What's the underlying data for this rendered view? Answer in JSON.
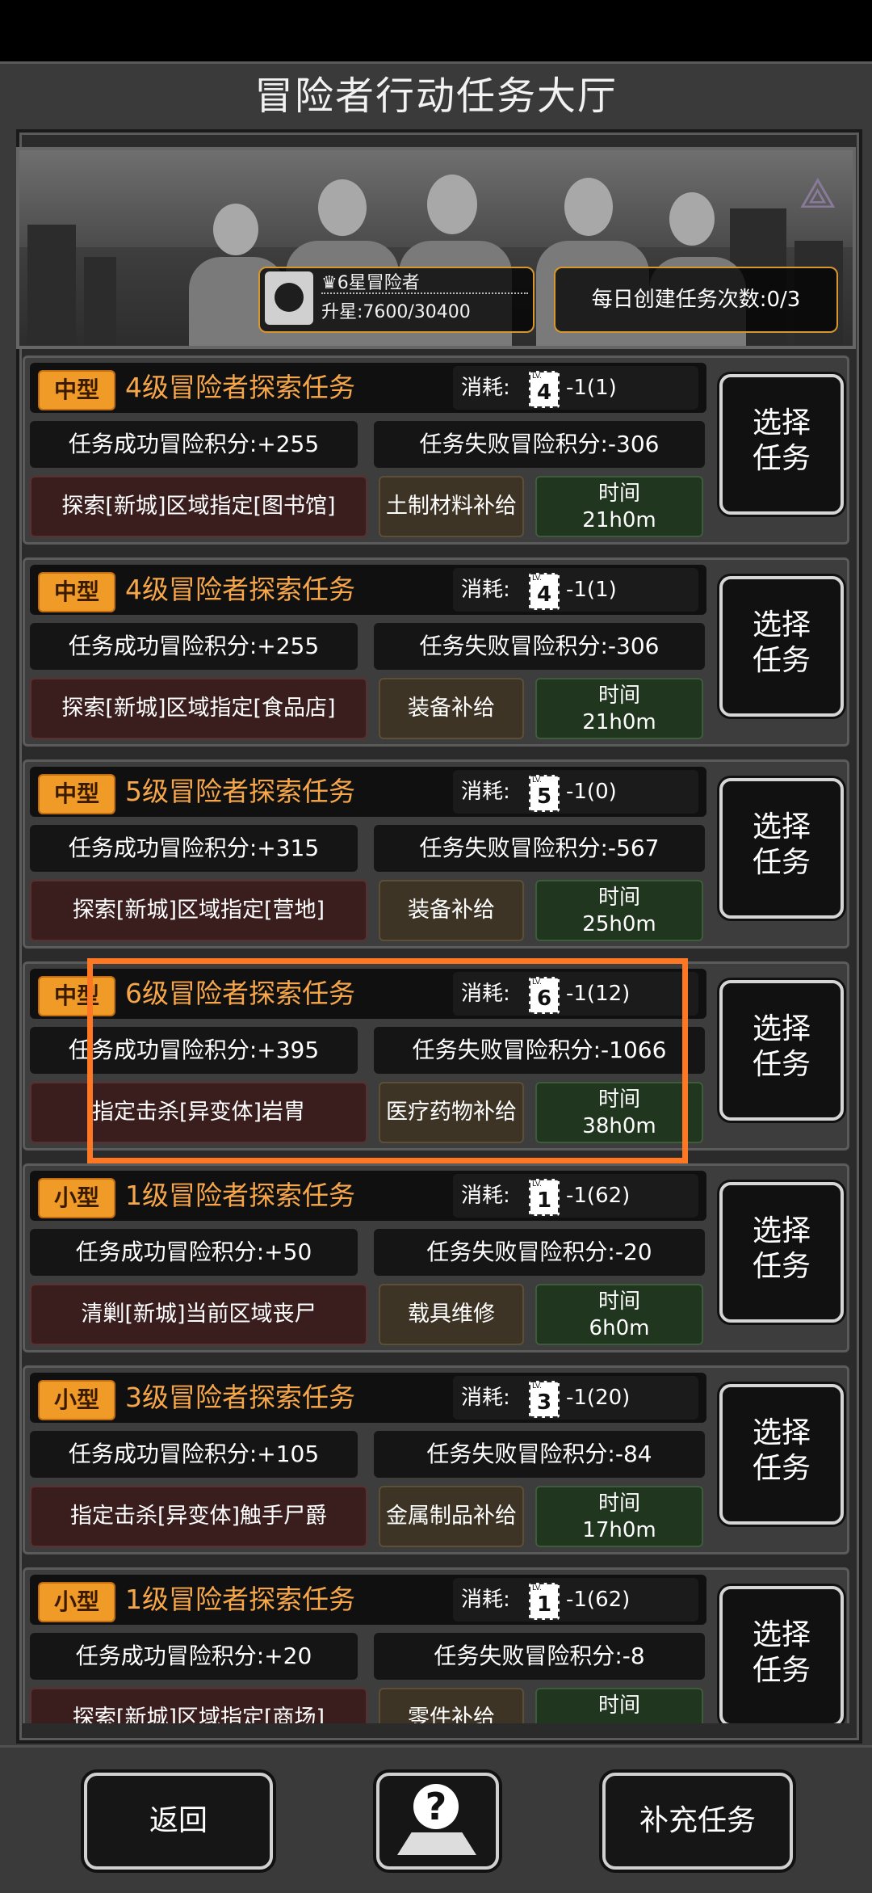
{
  "title": "冒险者行动任务大厅",
  "player": {
    "rank": "6星冒险者",
    "star_progress": "升星:7600/30400"
  },
  "daily_create": "每日创建任务次数:0/3",
  "cost_label": "消耗:",
  "lv_prefix": "LV.",
  "select_line1": "选择",
  "select_line2": "任务",
  "time_label": "时间",
  "tasks": [
    {
      "size": "中型",
      "name": "4级冒险者探索任务",
      "lv": "4",
      "cost": "-1(1)",
      "success": "任务成功冒险积分:+255",
      "fail": "任务失败冒险积分:-306",
      "target": "探索[新城]区域指定[图书馆]",
      "supply": "土制材料补给",
      "time": "21h0m"
    },
    {
      "size": "中型",
      "name": "4级冒险者探索任务",
      "lv": "4",
      "cost": "-1(1)",
      "success": "任务成功冒险积分:+255",
      "fail": "任务失败冒险积分:-306",
      "target": "探索[新城]区域指定[食品店]",
      "supply": "装备补给",
      "time": "21h0m"
    },
    {
      "size": "中型",
      "name": "5级冒险者探索任务",
      "lv": "5",
      "cost": "-1(0)",
      "success": "任务成功冒险积分:+315",
      "fail": "任务失败冒险积分:-567",
      "target": "探索[新城]区域指定[营地]",
      "supply": "装备补给",
      "time": "25h0m"
    },
    {
      "size": "中型",
      "name": "6级冒险者探索任务",
      "lv": "6",
      "cost": "-1(12)",
      "success": "任务成功冒险积分:+395",
      "fail": "任务失败冒险积分:-1066",
      "target": "指定击杀[异变体]岩胄",
      "supply": "医疗药物补给",
      "time": "38h0m"
    },
    {
      "size": "小型",
      "name": "1级冒险者探索任务",
      "lv": "1",
      "cost": "-1(62)",
      "success": "任务成功冒险积分:+50",
      "fail": "任务失败冒险积分:-20",
      "target": "清剿[新城]当前区域丧尸",
      "supply": "载具维修",
      "time": "6h0m"
    },
    {
      "size": "小型",
      "name": "3级冒险者探索任务",
      "lv": "3",
      "cost": "-1(20)",
      "success": "任务成功冒险积分:+105",
      "fail": "任务失败冒险积分:-84",
      "target": "指定击杀[异变体]触手尸爵",
      "supply": "金属制品补给",
      "time": "17h0m"
    },
    {
      "size": "小型",
      "name": "1级冒险者探索任务",
      "lv": "1",
      "cost": "-1(62)",
      "success": "任务成功冒险积分:+20",
      "fail": "任务失败冒险积分:-8",
      "target": "探索[新城]区域指定[商场]",
      "supply": "零件补给",
      "time": ""
    }
  ],
  "buttons": {
    "back": "返回",
    "replenish": "补充任务"
  },
  "icons": {
    "help": "help-map-icon",
    "emblem": "faction-emblem-icon"
  },
  "colors": {
    "accent_orange": "#f09a28",
    "highlight": "#ff7722",
    "task_name": "#f7a74a"
  }
}
